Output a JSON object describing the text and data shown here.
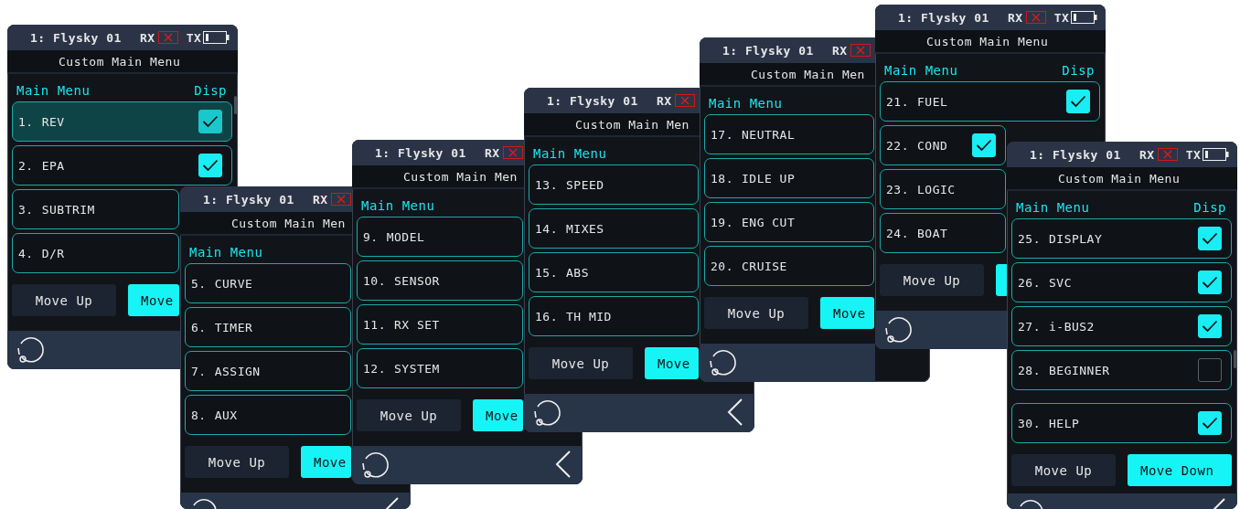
{
  "screens": [
    {
      "status": {
        "model": "1: Flysky 01",
        "rx": "RX",
        "tx": "TX"
      },
      "title": "Custom Main Menu",
      "header": {
        "label": "Main Menu",
        "disp": "Disp"
      },
      "rows": [
        {
          "number": "1.",
          "label": "REV",
          "selected": true,
          "checked": true
        },
        {
          "number": "2.",
          "label": "EPA",
          "selected": false,
          "checked": true
        },
        {
          "number": "3.",
          "label": "SUBTRIM",
          "selected": false
        },
        {
          "number": "4.",
          "label": "D/R",
          "selected": false
        }
      ],
      "buttons": [
        {
          "kind": "secondary",
          "label": "Move Up"
        },
        {
          "kind": "primary",
          "label": "Move"
        }
      ]
    },
    {
      "status": {
        "model": "1: Flysky 01",
        "rx": "RX"
      },
      "title": "Custom Main Men",
      "header": {
        "label": "Main Menu"
      },
      "rows": [
        {
          "number": "5.",
          "label": "CURVE",
          "selected": false
        },
        {
          "number": "6.",
          "label": "TIMER",
          "selected": false
        },
        {
          "number": "7.",
          "label": "ASSIGN",
          "selected": false
        },
        {
          "number": "8.",
          "label": "AUX",
          "selected": false
        }
      ],
      "buttons": [
        {
          "kind": "secondary",
          "label": "Move Up"
        },
        {
          "kind": "primary",
          "label": "Move"
        }
      ]
    },
    {
      "status": {
        "model": "1: Flysky 01",
        "rx": "RX"
      },
      "title": "Custom Main Men",
      "header": {
        "label": "Main Menu"
      },
      "rows": [
        {
          "number": "9.",
          "label": "MODEL",
          "selected": false
        },
        {
          "number": "10.",
          "label": "SENSOR",
          "selected": false
        },
        {
          "number": "11.",
          "label": "RX SET",
          "selected": false
        },
        {
          "number": "12.",
          "label": "SYSTEM",
          "selected": false
        }
      ],
      "buttons": [
        {
          "kind": "secondary",
          "label": "Move Up"
        },
        {
          "kind": "primary",
          "label": "Move"
        }
      ]
    },
    {
      "status": {
        "model": "1: Flysky 01",
        "rx": "RX"
      },
      "title": "Custom Main Men",
      "header": {
        "label": "Main Menu"
      },
      "rows": [
        {
          "number": "13.",
          "label": "SPEED",
          "selected": false
        },
        {
          "number": "14.",
          "label": "MIXES",
          "selected": false
        },
        {
          "number": "15.",
          "label": "ABS",
          "selected": false
        },
        {
          "number": "16.",
          "label": "TH MID",
          "selected": false
        }
      ],
      "buttons": [
        {
          "kind": "secondary",
          "label": "Move Up"
        },
        {
          "kind": "primary",
          "label": "Move"
        }
      ]
    },
    {
      "status": {
        "model": "1: Flysky 01",
        "rx": "RX"
      },
      "title": "Custom Main Men",
      "header": {
        "label": "Main Menu"
      },
      "rows": [
        {
          "number": "17.",
          "label": "NEUTRAL",
          "selected": false
        },
        {
          "number": "18.",
          "label": "IDLE UP",
          "selected": false
        },
        {
          "number": "19.",
          "label": "ENG CUT",
          "selected": false
        },
        {
          "number": "20.",
          "label": "CRUISE",
          "selected": false
        }
      ],
      "buttons": [
        {
          "kind": "secondary",
          "label": "Move Up"
        },
        {
          "kind": "primary",
          "label": "Move"
        }
      ]
    },
    {
      "status": {
        "model": "1: Flysky 01",
        "rx": "RX",
        "tx": "TX"
      },
      "title": "Custom Main Menu",
      "header": {
        "label": "Main Menu",
        "disp": "Disp"
      },
      "rows": [
        {
          "number": "21.",
          "label": "FUEL",
          "selected": false,
          "checked": true
        },
        {
          "number": "22.",
          "label": "COND",
          "selected": false,
          "checked": true
        },
        {
          "number": "23.",
          "label": "LOGIC",
          "selected": false
        },
        {
          "number": "24.",
          "label": "BOAT",
          "selected": false
        }
      ],
      "buttons": [
        {
          "kind": "secondary",
          "label": "Move Up"
        },
        {
          "kind": "primary"
        }
      ]
    },
    {
      "status": {
        "model": "1: Flysky 01",
        "rx": "RX",
        "tx": "TX"
      },
      "title": "Custom Main Menu",
      "header": {
        "label": "Main Menu",
        "disp": "Disp"
      },
      "rows": [
        {
          "number": "25.",
          "label": "DISPLAY",
          "selected": false,
          "checked": true
        },
        {
          "number": "26.",
          "label": "SVC",
          "selected": false,
          "checked": true
        },
        {
          "number": "27.",
          "label": "i-BUS2",
          "selected": false,
          "checked": true
        },
        {
          "number": "28.",
          "label": "BEGINNER",
          "selected": false,
          "checked": false
        },
        {
          "number": "30.",
          "label": "HELP",
          "selected": false,
          "checked": true
        }
      ],
      "buttons": [
        {
          "kind": "secondary",
          "label": "Move Up"
        },
        {
          "kind": "primary",
          "label": "Move Down"
        }
      ]
    }
  ]
}
